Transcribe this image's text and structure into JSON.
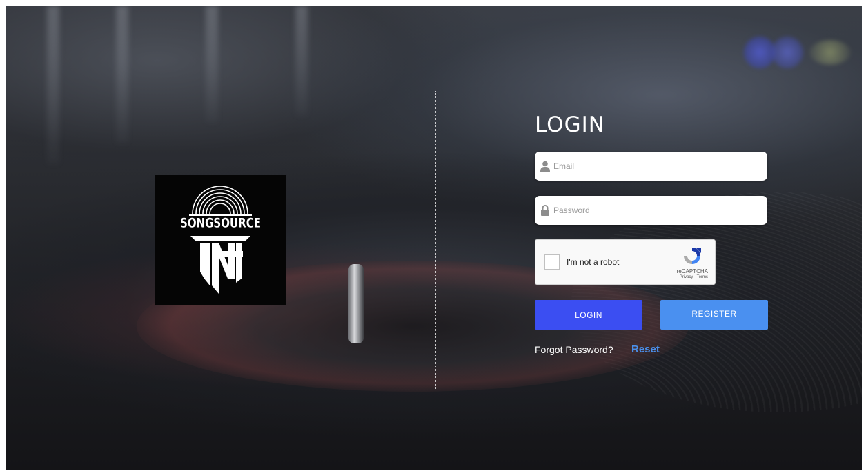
{
  "logo": {
    "brand_text": "SONGSOURCE",
    "icon": "vinyl-record-tn-logo"
  },
  "login_form": {
    "title": "LOGIN",
    "email": {
      "placeholder": "Email",
      "value": "",
      "icon": "user-icon"
    },
    "password": {
      "placeholder": "Password",
      "value": "",
      "icon": "lock-icon"
    },
    "captcha": {
      "label": "I'm not a robot",
      "brand": "reCAPTCHA",
      "links": "Privacy - Terms",
      "checked": false
    },
    "login_button": "LOGIN",
    "register_button": "REGISTER",
    "forgot_text": "Forgot Password?",
    "reset_link": "Reset"
  },
  "colors": {
    "login_button": "#3b4ef2",
    "register_button": "#4a90f0",
    "reset_link": "#4a8fea"
  }
}
